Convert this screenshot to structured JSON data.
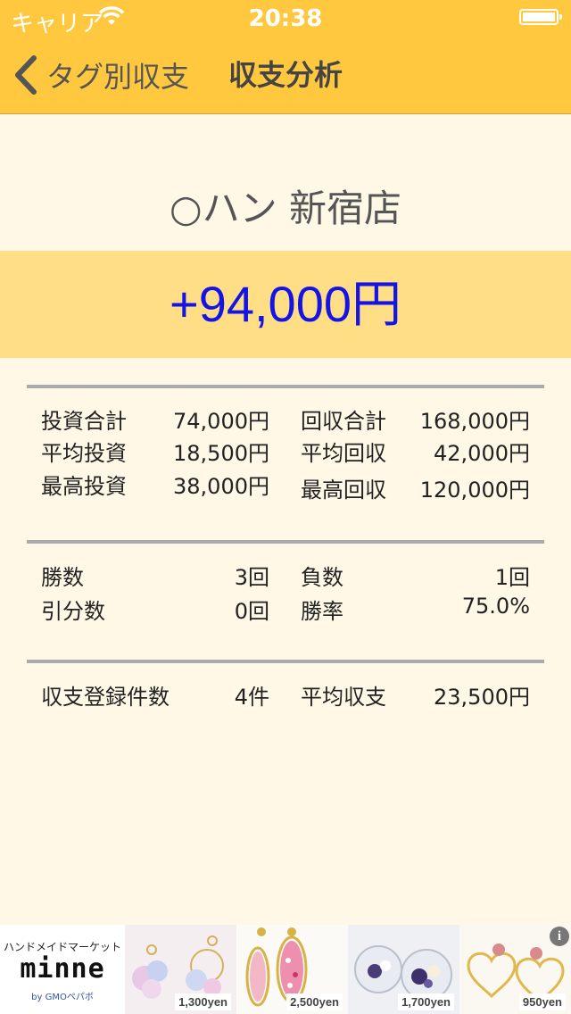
{
  "status_bar": {
    "carrier": "キャリア",
    "time": "20:38"
  },
  "nav": {
    "back_label": "タグ別収支",
    "title": "収支分析"
  },
  "summary": {
    "shop_name": "○ハン 新宿店",
    "total": "+94,000円"
  },
  "stats": {
    "investment": [
      {
        "label": "投資合計",
        "value": "74,000円",
        "label2": "回収合計",
        "value2": "168,000円"
      },
      {
        "label": "平均投資",
        "value": "18,500円",
        "label2": "平均回収",
        "value2": "42,000円"
      },
      {
        "label": "最高投資",
        "value": "38,000円",
        "label2": "最高回収",
        "value2": "120,000円"
      }
    ],
    "record": [
      {
        "label": "勝数",
        "value": "3回",
        "label2": "負数",
        "value2": "1回"
      },
      {
        "label": "引分数",
        "value": "0回",
        "label2": "勝率",
        "value2": "75.0%"
      }
    ],
    "count": [
      {
        "label": "収支登録件数",
        "value": "4件",
        "label2": "平均収支",
        "value2": "23,500円"
      }
    ]
  },
  "ad": {
    "tagline": "ハンドメイドマーケット",
    "brand": "minne",
    "by": "by GMOペパボ",
    "items": [
      {
        "price": "1,300yen"
      },
      {
        "price": "2,500yen"
      },
      {
        "price": "1,700yen"
      },
      {
        "price": "950yen"
      }
    ],
    "info_icon": "i"
  },
  "colors": {
    "accent": "#ffc83f",
    "total_band": "#ffde85",
    "total_text": "#1414e6",
    "background": "#fff8e6"
  }
}
